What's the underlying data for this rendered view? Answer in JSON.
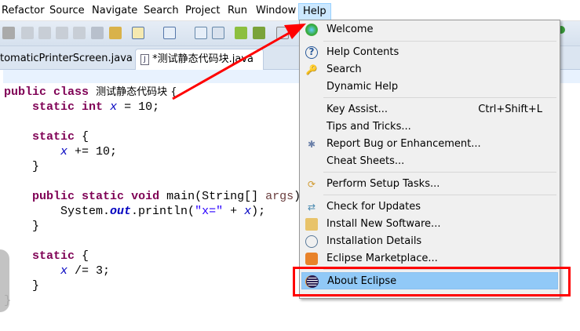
{
  "menubar": {
    "items": [
      "Refactor",
      "Source",
      "Navigate",
      "Search",
      "Project",
      "Run",
      "Window",
      "Help"
    ]
  },
  "tabs": [
    {
      "label": "tomaticPrinterScreen.java"
    },
    {
      "label": "*测试静态代码块.java"
    }
  ],
  "code": {
    "l1a": "public",
    "l1b": "class",
    "l1c": "测试静态代码块 {",
    "static": "static",
    "int": "int",
    "x": "x",
    "l2r": " = 10;",
    "brace_open": " {",
    "l5r": " += 10;",
    "close": "}",
    "public": "public",
    "void": "void",
    "main": " main(String[] ",
    "args": "args",
    "rparen": ")",
    "sys": "System.",
    "out": "out",
    "println": ".println(",
    "str": "\"x=\"",
    "plus": " + ",
    "end": ");",
    "l13r": " /= 3;"
  },
  "help_menu": {
    "items": [
      {
        "label": "Welcome",
        "icon": "welcome-icon"
      },
      {
        "label": "Help Contents",
        "icon": "help-icon"
      },
      {
        "label": "Search",
        "icon": "search-icon"
      },
      {
        "label": "Dynamic Help",
        "icon": ""
      },
      {
        "label": "Key Assist...",
        "shortcut": "Ctrl+Shift+L",
        "icon": ""
      },
      {
        "label": "Tips and Tricks...",
        "icon": ""
      },
      {
        "label": "Report Bug or Enhancement...",
        "icon": "bug-icon"
      },
      {
        "label": "Cheat Sheets...",
        "icon": ""
      },
      {
        "label": "Perform Setup Tasks...",
        "icon": "setup-icon"
      },
      {
        "label": "Check for Updates",
        "icon": "update-icon"
      },
      {
        "label": "Install New Software...",
        "icon": "install-icon"
      },
      {
        "label": "Installation Details",
        "icon": "details-icon"
      },
      {
        "label": "Eclipse Marketplace...",
        "icon": "marketplace-icon"
      },
      {
        "label": "About Eclipse",
        "icon": "eclipse-icon"
      }
    ]
  },
  "colors": {
    "highlight": "#91c9f7",
    "annotation": "#ff0000",
    "keyword": "#7f0055"
  }
}
